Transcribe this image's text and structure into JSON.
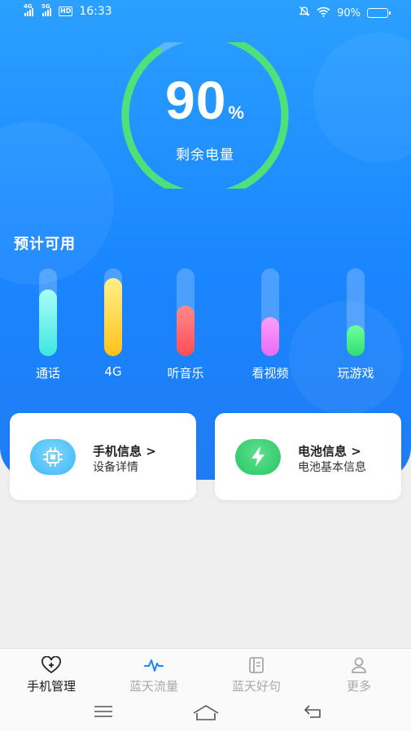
{
  "status_bar": {
    "sim1": "4G",
    "sim2": "5G",
    "hd": "HD",
    "time": "16:33",
    "battery_text": "90%",
    "battery_level": 0.9,
    "icons": [
      "mute-icon",
      "wifi-icon",
      "battery-icon"
    ]
  },
  "battery_ring": {
    "value": "90",
    "unit": "%",
    "label": "剩余电量",
    "level": 0.9,
    "color": "#4fe07a"
  },
  "usage": {
    "title": "预计可用",
    "items": [
      {
        "label": "通话",
        "level": 0.76,
        "color_top": "#a8fff6",
        "color_bottom": "#3fe6e0"
      },
      {
        "label": "4G",
        "level": 0.89,
        "color_top": "#fff08a",
        "color_bottom": "#ffc21a"
      },
      {
        "label": "听音乐",
        "level": 0.57,
        "color_top": "#ff8a8a",
        "color_bottom": "#ff4d55"
      },
      {
        "label": "看视频",
        "level": 0.44,
        "color_top": "#ff9dfc",
        "color_bottom": "#e86bf3"
      },
      {
        "label": "玩游戏",
        "level": 0.35,
        "color_top": "#6dff9c",
        "color_bottom": "#2fe070"
      }
    ]
  },
  "cards": [
    {
      "title": "手机信息 >",
      "subtitle": "设备详情",
      "icon": "chip-icon",
      "color": "#3fb8f5"
    },
    {
      "title": "电池信息 >",
      "subtitle": "电池基本信息",
      "icon": "lightning-icon",
      "color": "#26c663"
    }
  ],
  "tabs": [
    {
      "label": "手机管理",
      "icon": "heart-plus-icon",
      "active": true
    },
    {
      "label": "蓝天流量",
      "icon": "pulse-icon",
      "active": false
    },
    {
      "label": "蓝天好句",
      "icon": "book-icon",
      "active": false
    },
    {
      "label": "更多",
      "icon": "person-icon",
      "active": false
    }
  ],
  "nav": [
    "menu-icon",
    "home-icon",
    "back-icon"
  ],
  "colors": {
    "accent": "#1a86ff",
    "tab_active": "#1a1a1a",
    "tab_inactive": "#a8a8a8",
    "pulse": "#1a86ff"
  }
}
